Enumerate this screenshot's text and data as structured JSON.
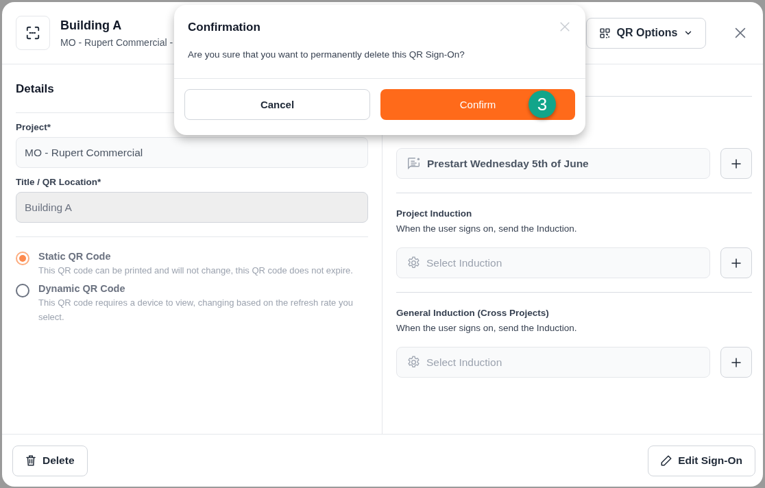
{
  "header": {
    "title": "Building A",
    "subtitle": "MO - Rupert Commercial -",
    "qr_options_button": "QR Options"
  },
  "details": {
    "heading": "Details",
    "fields": [
      {
        "label": "Project*",
        "value": "MO - Rupert Commercial",
        "disabled": false
      },
      {
        "label": "Title / QR Location*",
        "value": "Building A",
        "disabled": true
      }
    ],
    "qr_types": [
      {
        "title": "Static QR Code",
        "description": "This QR code can be printed and will not change, this QR code does not expire.",
        "selected": true
      },
      {
        "title": "Dynamic QR Code",
        "description": "This QR code requires a device to view, changing based on the refresh rate you select.",
        "selected": false
      }
    ]
  },
  "sign_on": {
    "prestart_value": "Prestart Wednesday 5th of June",
    "inductions": [
      {
        "heading": "Project Induction",
        "description": "When the user signs on, send the Induction.",
        "placeholder": "Select Induction"
      },
      {
        "heading": "General Induction (Cross Projects)",
        "description": "When the user signs on, send the Induction.",
        "placeholder": "Select Induction"
      }
    ]
  },
  "footer": {
    "delete_button": "Delete",
    "edit_button": "Edit Sign-On"
  },
  "dialog": {
    "title": "Confirmation",
    "message": "Are you sure that you want to permanently delete this QR Sign-On?",
    "cancel_button": "Cancel",
    "confirm_button": "Confirm",
    "step_badge": "3"
  }
}
